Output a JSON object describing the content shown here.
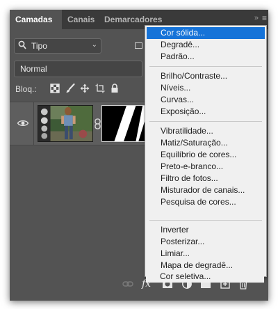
{
  "tabs": [
    {
      "label": "Camadas",
      "active": true
    },
    {
      "label": "Canais",
      "active": false
    },
    {
      "label": "Demarcadores",
      "active": false
    }
  ],
  "tab_icons": {
    "collapse": "double-chevron-icon",
    "menu": "panel-menu-icon"
  },
  "filter": {
    "label": "Tipo",
    "icon": "search-icon"
  },
  "blend_mode": "Normal",
  "lock": {
    "label": "Bloq.:"
  },
  "menu": {
    "groups": [
      [
        {
          "label": "Cor sólida...",
          "selected": true
        },
        {
          "label": "Degradê...",
          "selected": false
        },
        {
          "label": "Padrão...",
          "selected": false
        }
      ],
      [
        {
          "label": "Brilho/Contraste...",
          "selected": false
        },
        {
          "label": "Níveis...",
          "selected": false
        },
        {
          "label": "Curvas...",
          "selected": false
        },
        {
          "label": "Exposição...",
          "selected": false
        }
      ],
      [
        {
          "label": "Vibratilidade...",
          "selected": false
        },
        {
          "label": "Matiz/Saturação...",
          "selected": false
        },
        {
          "label": "Equilíbrio de cores...",
          "selected": false
        },
        {
          "label": "Preto-e-branco...",
          "selected": false
        },
        {
          "label": "Filtro de fotos...",
          "selected": false
        },
        {
          "label": "Misturador de canais...",
          "selected": false
        },
        {
          "label": "Pesquisa de cores...",
          "selected": false
        }
      ],
      [
        {
          "label": "Inverter",
          "selected": false
        },
        {
          "label": "Posterizar...",
          "selected": false
        },
        {
          "label": "Limiar...",
          "selected": false
        },
        {
          "label": "Mapa de degradê...",
          "selected": false
        },
        {
          "label": "Cor seletiva...",
          "selected": false
        }
      ]
    ]
  },
  "bottom_icons": [
    "link-layers-icon",
    "fx-icon",
    "add-mask-icon",
    "adjustment-layer-icon",
    "new-group-icon",
    "new-layer-icon",
    "delete-icon"
  ],
  "colors": {
    "panel": "#535353",
    "tabbar": "#3a3a3a",
    "menu_bg": "#f0f0f0",
    "menu_highlight": "#1673d8"
  }
}
